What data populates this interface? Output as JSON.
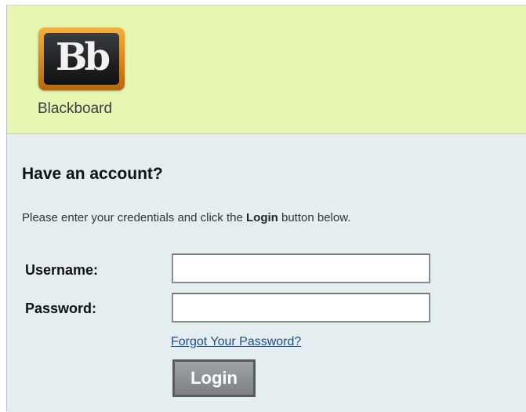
{
  "brand": {
    "logo_mark": "Bb",
    "name": "Blackboard"
  },
  "login": {
    "title": "Have an account?",
    "instructions_prefix": "Please enter your credentials and click the ",
    "instructions_bold": "Login",
    "instructions_suffix": " button below.",
    "username_label": "Username:",
    "username_value": "",
    "password_label": "Password:",
    "password_value": "",
    "forgot_link": "Forgot Your Password?",
    "submit_label": "Login"
  },
  "colors": {
    "header_bg": "#e6f5b0",
    "content_bg": "#e4eef0",
    "link": "#1f4e8c",
    "button_bg": "#8a8e91"
  }
}
